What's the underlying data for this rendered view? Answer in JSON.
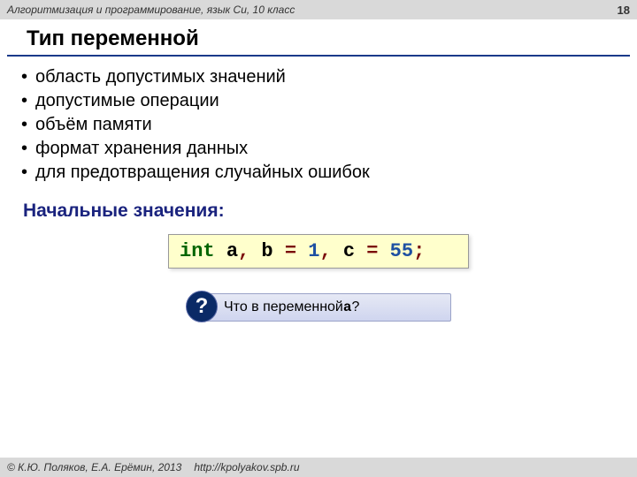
{
  "header": {
    "course": "Алгоритмизация и программирование, язык Си, 10 класс",
    "page": "18"
  },
  "title": "Тип переменной",
  "bullets": [
    "область допустимых значений",
    "допустимые операции",
    "объём памяти",
    "формат хранения данных",
    "для предотвращения случайных ошибок"
  ],
  "subheading": "Начальные значения:",
  "code": {
    "kw": "int",
    "v1": "a",
    "c1": ",",
    "v2": "b",
    "eq1": "=",
    "n1": "1",
    "c2": ",",
    "v3": "c",
    "eq2": "=",
    "n2": "55",
    "semi": ";"
  },
  "question": {
    "badge": "?",
    "text_before": "Что в переменной ",
    "mono": "a",
    "text_after": "?"
  },
  "footer": {
    "copyright": "© К.Ю. Поляков, Е.А. Ерёмин, 2013",
    "url": "http://kpolyakov.spb.ru"
  }
}
